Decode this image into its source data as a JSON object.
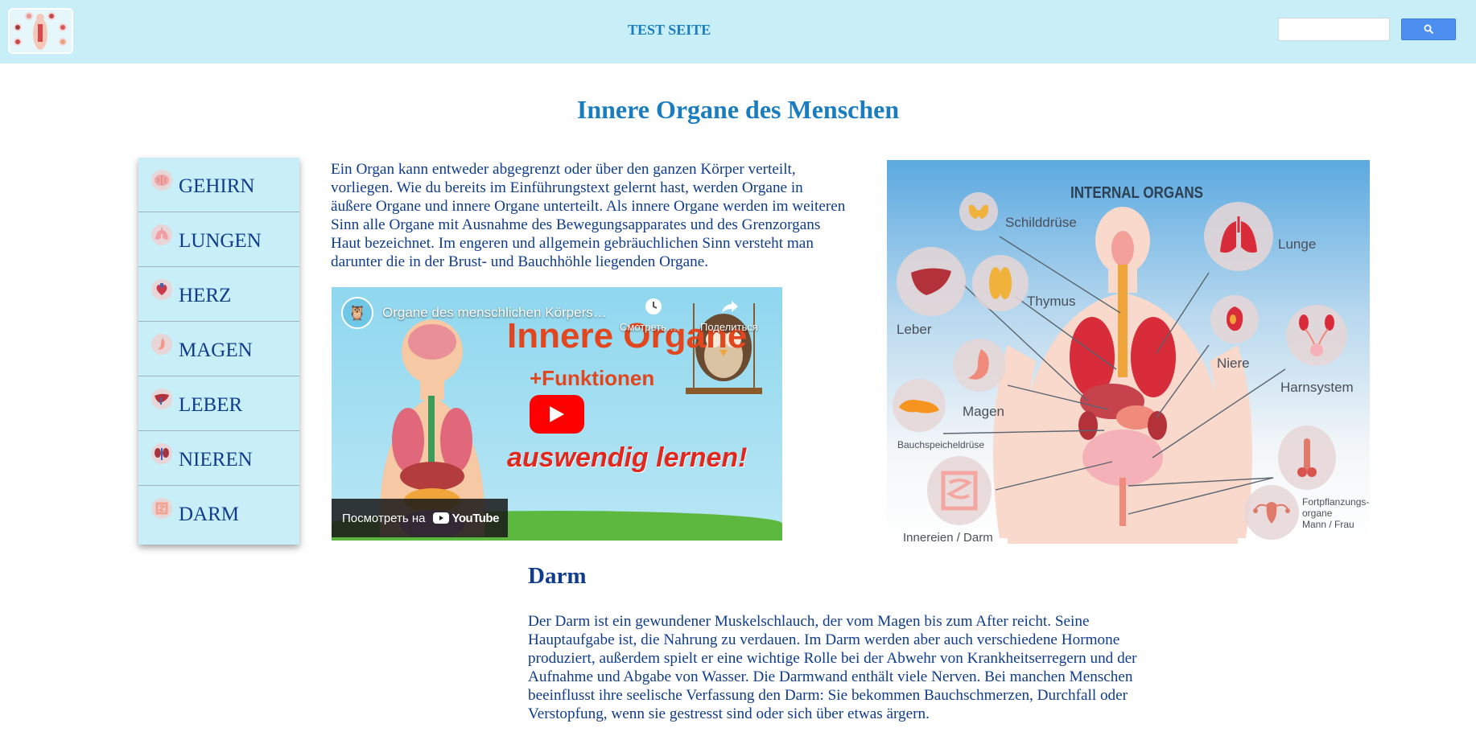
{
  "header": {
    "site_title": "TEST SEITE",
    "search_placeholder": "",
    "search_button_icon": "search-icon",
    "logo_icon": "organs-logo",
    "background": "#c8eff7"
  },
  "page_title": "Innere Organe des Menschen",
  "sidebar": {
    "items": [
      {
        "label": "GEHIRN",
        "icon": "brain-icon"
      },
      {
        "label": "LUNGEN",
        "icon": "lungs-icon"
      },
      {
        "label": "HERZ",
        "icon": "heart-icon"
      },
      {
        "label": "MAGEN",
        "icon": "stomach-icon"
      },
      {
        "label": "LEBER",
        "icon": "liver-icon"
      },
      {
        "label": "NIEREN",
        "icon": "kidneys-icon"
      },
      {
        "label": "DARM",
        "icon": "intestine-icon"
      }
    ]
  },
  "intro_text": "Ein Organ kann entweder abgegrenzt oder über den ganzen Körper verteilt, vorliegen. Wie du bereits im Einführungstext gelernt hast, werden Organe in äußere Organe und innere Organe unterteilt. Als innere Organe werden im weiteren Sinn alle Organe mit Ausnahme des Bewegungsapparates und des Grenzorgans Haut bezeichnet. Im engeren und allgemein gebräuchlichen Sinn versteht man darunter die in der Brust- und Bauchhöhle liegenden Organe.",
  "video": {
    "title": "Organe des menschlichen Körpers…",
    "watch_later": "Смотреть…",
    "share": "Поделиться",
    "headline": "Innere Organe",
    "subheadline": "+Funktionen",
    "tagline": "auswendig lernen!",
    "watch_on": "Посмотреть на",
    "youtube": "YouTube"
  },
  "organs_image": {
    "heading": "INTERNAL ORGANS",
    "labels": {
      "schilddruese": "Schilddrüse",
      "lunge": "Lunge",
      "thymus": "Thymus",
      "leber": "Leber",
      "niere": "Niere",
      "harnsystem": "Harnsystem",
      "magen": "Magen",
      "bauchspeicheldruese": "Bauchspeicheldrüse",
      "innereien": "Innereien / Darm",
      "fortpflanzung_1": "Fortpflanzungs-",
      "fortpflanzung_2": "organe",
      "fortpflanzung_3": "Mann / Frau"
    }
  },
  "section": {
    "title": "Darm",
    "text": "Der Darm ist ein gewundener Muskelschlauch, der vom Magen bis zum After reicht. Seine Hauptaufgabe ist, die Nahrung zu verdauen. Im Darm werden aber auch verschiedene Hormone produziert, außerdem spielt er eine wichtige Rolle bei der Abwehr von Krankheitserregern und der Aufnahme und Abgabe von Wasser. Die Darmwand enthält viele Nerven. Bei manchen Menschen beeinflusst ihre seelische Verfassung den Darm: Sie bekommen Bauchschmerzen, Durchfall oder Verstopfung, wenn sie gestresst sind oder sich über etwas ärgern."
  }
}
